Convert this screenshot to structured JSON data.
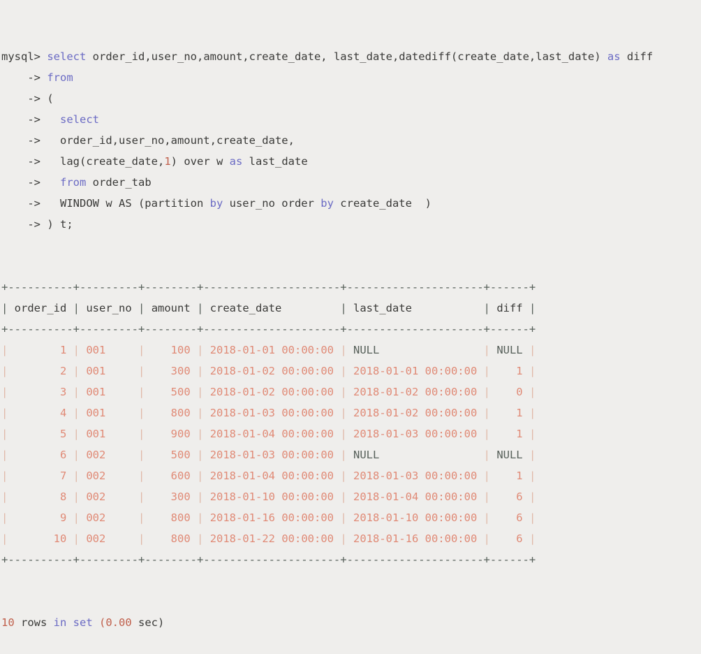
{
  "terminal": {
    "prompt": "mysql>",
    "continuation": "->",
    "query_lines": [
      {
        "prefix": "mysql>",
        "tokens": [
          {
            "t": " ",
            "c": "plain"
          },
          {
            "t": "select",
            "c": "kw"
          },
          {
            "t": " order_id,user_no,amount,create_date, last_date,datediff(create_date,last_date) ",
            "c": "plain"
          },
          {
            "t": "as",
            "c": "kw"
          },
          {
            "t": " diff",
            "c": "plain"
          }
        ]
      },
      {
        "prefix": "    ->",
        "tokens": [
          {
            "t": " ",
            "c": "plain"
          },
          {
            "t": "from",
            "c": "kw"
          }
        ]
      },
      {
        "prefix": "    ->",
        "tokens": [
          {
            "t": " (",
            "c": "plain"
          }
        ]
      },
      {
        "prefix": "    ->",
        "tokens": [
          {
            "t": "   ",
            "c": "plain"
          },
          {
            "t": "select",
            "c": "kw"
          }
        ]
      },
      {
        "prefix": "    ->",
        "tokens": [
          {
            "t": "   order_id,user_no,amount,create_date,",
            "c": "plain"
          }
        ]
      },
      {
        "prefix": "    ->",
        "tokens": [
          {
            "t": "   lag(create_date,",
            "c": "plain"
          },
          {
            "t": "1",
            "c": "num"
          },
          {
            "t": ") over w ",
            "c": "plain"
          },
          {
            "t": "as",
            "c": "kw"
          },
          {
            "t": " last_date",
            "c": "plain"
          }
        ]
      },
      {
        "prefix": "    ->",
        "tokens": [
          {
            "t": "   ",
            "c": "plain"
          },
          {
            "t": "from",
            "c": "kw"
          },
          {
            "t": " order_tab",
            "c": "plain"
          }
        ]
      },
      {
        "prefix": "    ->",
        "tokens": [
          {
            "t": "   WINDOW w AS (partition ",
            "c": "plain"
          },
          {
            "t": "by",
            "c": "kw"
          },
          {
            "t": " user_no order ",
            "c": "plain"
          },
          {
            "t": "by",
            "c": "kw"
          },
          {
            "t": " create_date  )",
            "c": "plain"
          }
        ]
      },
      {
        "prefix": "    ->",
        "tokens": [
          {
            "t": " ) t;",
            "c": "plain"
          }
        ]
      }
    ],
    "result_table": {
      "columns": [
        {
          "name": "order_id",
          "width": 10,
          "align": "right"
        },
        {
          "name": "user_no",
          "width": 9,
          "align": "left"
        },
        {
          "name": "amount",
          "width": 8,
          "align": "right"
        },
        {
          "name": "create_date",
          "width": 21,
          "align": "left"
        },
        {
          "name": "last_date",
          "width": 21,
          "align": "left"
        },
        {
          "name": "diff",
          "width": 6,
          "align": "right"
        }
      ],
      "rows": [
        {
          "order_id": "1",
          "user_no": "001",
          "amount": "100",
          "create_date": "2018-01-01 00:00:00",
          "last_date": "NULL",
          "diff": "NULL"
        },
        {
          "order_id": "2",
          "user_no": "001",
          "amount": "300",
          "create_date": "2018-01-02 00:00:00",
          "last_date": "2018-01-01 00:00:00",
          "diff": "1"
        },
        {
          "order_id": "3",
          "user_no": "001",
          "amount": "500",
          "create_date": "2018-01-02 00:00:00",
          "last_date": "2018-01-02 00:00:00",
          "diff": "0"
        },
        {
          "order_id": "4",
          "user_no": "001",
          "amount": "800",
          "create_date": "2018-01-03 00:00:00",
          "last_date": "2018-01-02 00:00:00",
          "diff": "1"
        },
        {
          "order_id": "5",
          "user_no": "001",
          "amount": "900",
          "create_date": "2018-01-04 00:00:00",
          "last_date": "2018-01-03 00:00:00",
          "diff": "1"
        },
        {
          "order_id": "6",
          "user_no": "002",
          "amount": "500",
          "create_date": "2018-01-03 00:00:00",
          "last_date": "NULL",
          "diff": "NULL"
        },
        {
          "order_id": "7",
          "user_no": "002",
          "amount": "600",
          "create_date": "2018-01-04 00:00:00",
          "last_date": "2018-01-03 00:00:00",
          "diff": "1"
        },
        {
          "order_id": "8",
          "user_no": "002",
          "amount": "300",
          "create_date": "2018-01-10 00:00:00",
          "last_date": "2018-01-04 00:00:00",
          "diff": "6"
        },
        {
          "order_id": "9",
          "user_no": "002",
          "amount": "800",
          "create_date": "2018-01-16 00:00:00",
          "last_date": "2018-01-10 00:00:00",
          "diff": "6"
        },
        {
          "order_id": "10",
          "user_no": "002",
          "amount": "800",
          "create_date": "2018-01-22 00:00:00",
          "last_date": "2018-01-16 00:00:00",
          "diff": "6"
        }
      ]
    },
    "status_line": {
      "count": "10",
      "rows_word": " rows ",
      "in_set": "in set",
      "timing": " (0.00",
      "unit": " sec)"
    }
  },
  "colors": {
    "background": "#efeeec",
    "keyword": "#6b6bc4",
    "number": "#c0604c",
    "value": "#e08a76",
    "text": "#3a3a38",
    "rule": "#57605a",
    "null": "#57605a"
  }
}
